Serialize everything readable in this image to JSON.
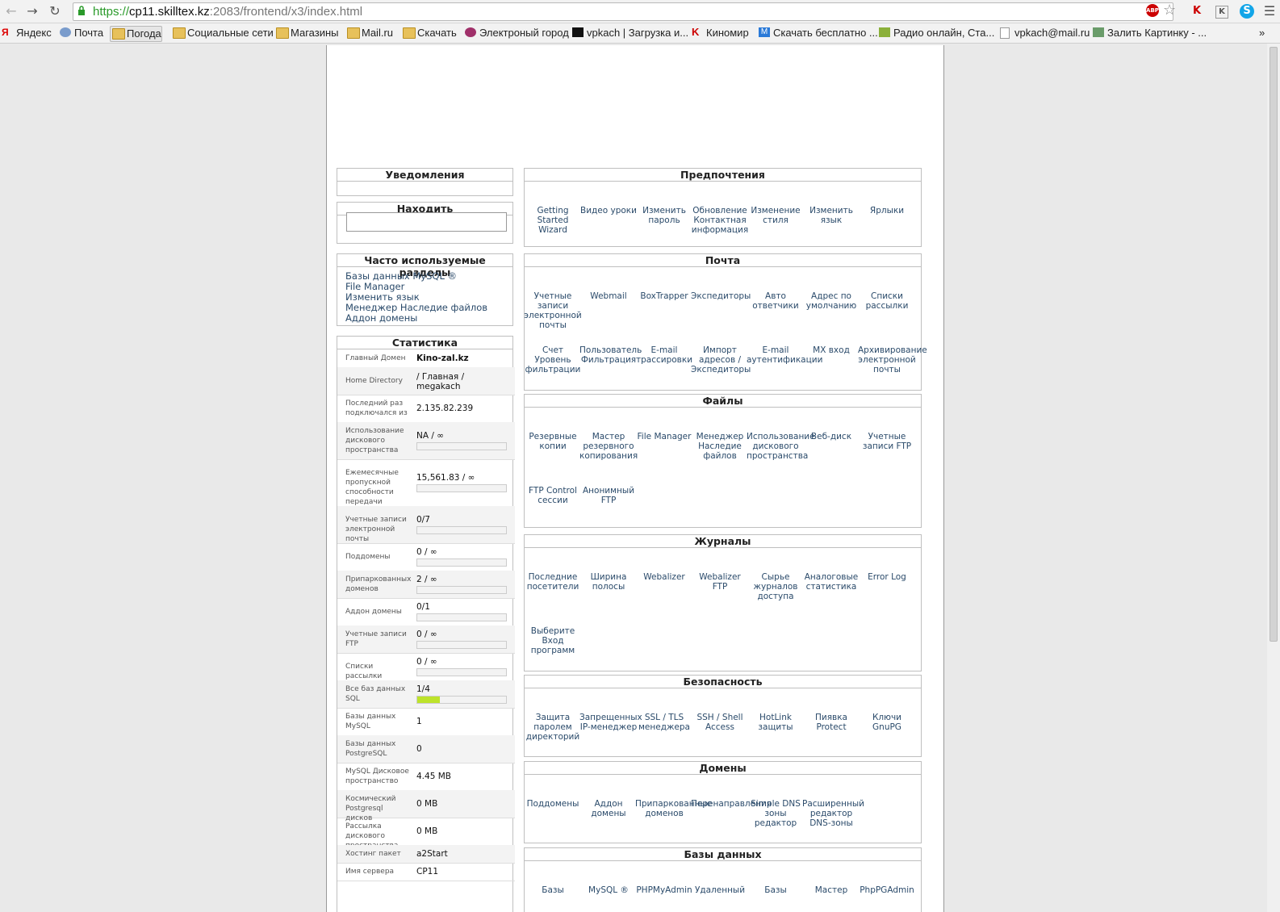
{
  "browser": {
    "url_scheme": "https://",
    "url_host": "cp11.skilltex.kz",
    "url_path": ":2083/frontend/x3/index.html",
    "abp": "ABP"
  },
  "bookmarks": [
    {
      "label": "Яндекс"
    },
    {
      "label": "Почта"
    },
    {
      "label": "Погода"
    },
    {
      "label": "Социальные сети"
    },
    {
      "label": "Магазины"
    },
    {
      "label": "Mail.ru"
    },
    {
      "label": "Скачать"
    },
    {
      "label": "Электроный город"
    },
    {
      "label": "vpkach | Загрузка и..."
    },
    {
      "label": "Киномир"
    },
    {
      "label": "Скачать бесплатно ..."
    },
    {
      "label": "Радио онлайн, Ста..."
    },
    {
      "label": "vpkach@mail.ru"
    },
    {
      "label": "Залить Картинку - ..."
    }
  ],
  "sidebar": {
    "notifications_title": "Уведомления",
    "find_title": "Находить",
    "frequent_title": "Часто используемые разделы",
    "frequent": [
      "Базы данных MySQL ®",
      "File Manager",
      "Изменить язык",
      "Менеджер Наследие файлов",
      "Аддон домены"
    ],
    "stats_title": "Статистика",
    "stats": [
      {
        "label": "Главный Домен",
        "value": "Kino-zal.kz"
      },
      {
        "label": "Home Directory",
        "value": "/ Главная / megakach"
      },
      {
        "label": "Последний раз подключался из",
        "value": "2.135.82.239"
      },
      {
        "label": "Использование дискового пространства",
        "value": "NA / ∞",
        "fill": 0
      },
      {
        "label": "Ежемесячные пропускной способности передачи",
        "value": "15,561.83 / ∞",
        "fill": 0
      },
      {
        "label": "Учетные записи электронной почты",
        "value": "0/7",
        "fill": 0
      },
      {
        "label": "Поддомены",
        "value": "0 / ∞",
        "fill": 0
      },
      {
        "label": "Припаркованных доменов",
        "value": "2 / ∞",
        "fill": 0
      },
      {
        "label": "Аддон домены",
        "value": "0/1",
        "fill": 0
      },
      {
        "label": "Учетные записи FTP",
        "value": "0 / ∞",
        "fill": 0
      },
      {
        "label": "Списки рассылки",
        "value": "0 / ∞",
        "fill": 0
      },
      {
        "label": "Все баз данных SQL",
        "value": "1/4",
        "fill": 0.25
      },
      {
        "label": "Базы данных MySQL",
        "value": "1"
      },
      {
        "label": "Базы данных PostgreSQL",
        "value": "0"
      },
      {
        "label": "MySQL Дисковое пространство",
        "value": "4.45 MB"
      },
      {
        "label": "Космический Postgresql дисков",
        "value": "0 MB"
      },
      {
        "label": "Рассылка дискового пространства",
        "value": "0 MB"
      },
      {
        "label": "Хостинг пакет",
        "value": "a2Start"
      },
      {
        "label": "Имя сервера",
        "value": "CP11"
      }
    ]
  },
  "sections": [
    {
      "title": "Предпочтения",
      "items": [
        "Getting Started Wizard",
        "Видео уроки",
        "Изменить пароль",
        "Обновление Контактная информация",
        "Изменение стиля",
        "Изменить язык",
        "Ярлыки"
      ]
    },
    {
      "title": "Почта",
      "items": [
        "Учетные записи электронной почты",
        "Webmail",
        "BoxTrapper",
        "Экспедиторы",
        "Авто ответчики",
        "Адрес по умолчанию",
        "Списки рассылки",
        "Счет Уровень фильтрации",
        "Пользователь Фильтрация",
        "E-mail трассировки",
        "Импорт адресов / Экспедиторы",
        "E-mail аутентификации",
        "MX вход",
        "Архивирование электронной почты"
      ]
    },
    {
      "title": "Файлы",
      "items": [
        "Резервные копии",
        "Мастер резервного копирования",
        "File Manager",
        "Менеджер Наследие файлов",
        "Использование дискового пространства",
        "Веб-диск",
        "Учетные записи FTP",
        "FTP Control сессии",
        "Анонимный FTP"
      ]
    },
    {
      "title": "Журналы",
      "items": [
        "Последние посетители",
        "Ширина полосы",
        "Webalizer",
        "Webalizer FTP",
        "Сырье журналов доступа",
        "Аналоговые статистика",
        "Error Log",
        "Выберите Вход программ"
      ]
    },
    {
      "title": "Безопасность",
      "items": [
        "Защита паролем директорий",
        "Запрещенных IP-менеджер",
        "SSL / TLS менеджера",
        "SSH / Shell Access",
        "HotLink защиты",
        "Пиявка Protect",
        "Ключи GnuPG"
      ]
    },
    {
      "title": "Домены",
      "items": [
        "Поддомены",
        "Аддон домены",
        "Припаркованные доменов",
        "Перенаправления",
        "Simple DNS зоны редактор",
        "Расширенный редактор DNS-зоны"
      ]
    },
    {
      "title": "Базы данных",
      "items": [
        "Базы",
        "MySQL ®",
        "PHPMyAdmin",
        "Удаленный",
        "Базы",
        "Мастер",
        "PhpPGAdmin"
      ]
    }
  ]
}
